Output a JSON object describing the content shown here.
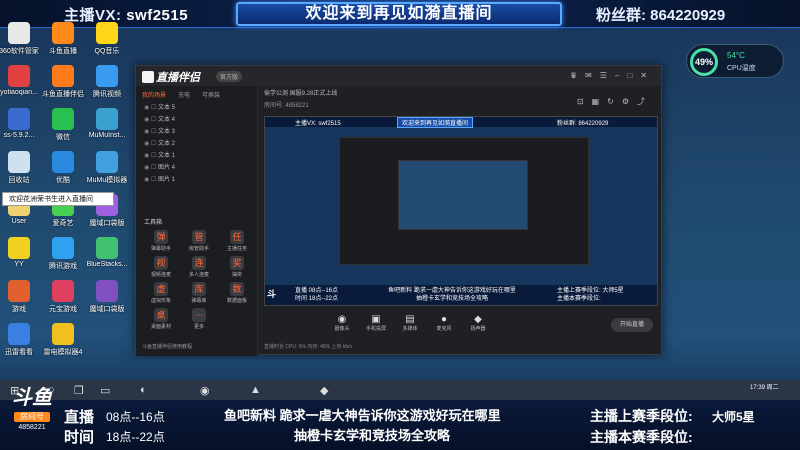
{
  "overlay_top": {
    "host_vx_label": "主播VX:",
    "host_vx_value": "swf2515",
    "banner_title": "欢迎来到再见如漪直播间",
    "fans_group": "粉丝群: 864220929"
  },
  "desktop_icons": [
    {
      "label": "360软件管家",
      "color": "#e8e8e8"
    },
    {
      "label": "斗鱼直播",
      "color": "#ff8a1a"
    },
    {
      "label": "QQ音乐",
      "color": "#ffd51a"
    },
    {
      "label": "yotiaoqian...",
      "color": "#e04040"
    },
    {
      "label": "斗鱼直播伴侣",
      "color": "#ff7a1a"
    },
    {
      "label": "腾讯视频",
      "color": "#3a9af0"
    },
    {
      "label": "ss-5.9.2...",
      "color": "#3a6ad0"
    },
    {
      "label": "微信",
      "color": "#2ac050"
    },
    {
      "label": "MuMuInst...",
      "color": "#3aa0d0"
    },
    {
      "label": "回收站",
      "color": "#d0e0f0"
    },
    {
      "label": "优酷",
      "color": "#2a8ae0"
    },
    {
      "label": "MuMu模拟器",
      "color": "#40a0e0"
    },
    {
      "label": "User",
      "color": "#f0d070"
    },
    {
      "label": "爱奇艺",
      "color": "#4ad050"
    },
    {
      "label": "魔域口袋版",
      "color": "#a060e0"
    },
    {
      "label": "YY",
      "color": "#f0d020"
    },
    {
      "label": "腾讯游戏",
      "color": "#30a0f0"
    },
    {
      "label": "BlueStacks...",
      "color": "#40c070"
    },
    {
      "label": "游戏",
      "color": "#e06030"
    },
    {
      "label": "元宝游戏",
      "color": "#e04060"
    },
    {
      "label": "魔域口袋版",
      "color": "#8050c0"
    },
    {
      "label": "迅雷看看",
      "color": "#3a80e0"
    },
    {
      "label": "雷电模拟器4",
      "color": "#f0c020"
    }
  ],
  "tooltip_text": "欢迎花洲荣书生进入直播间",
  "perf": {
    "percent": "49%",
    "temp": "54°C",
    "cpu": "CPU温度"
  },
  "app": {
    "name": "直播伴侣",
    "version": "官方版",
    "left_tabs": [
      "我的场景",
      "充电",
      "可换装"
    ],
    "layers": [
      "文本 5",
      "文本 4",
      "文本 3",
      "文本 2",
      "文本 1",
      "图片 4",
      "图片 1"
    ],
    "tools_title": "工具箱",
    "tools": [
      {
        "label": "弹幕助手",
        "icon": "弹"
      },
      {
        "label": "房管助手",
        "icon": "管"
      },
      {
        "label": "主播任务",
        "icon": "任"
      },
      {
        "label": "视频连麦",
        "icon": "视"
      },
      {
        "label": "多人连麦",
        "icon": "连"
      },
      {
        "label": "抽奖",
        "icon": "奖"
      },
      {
        "label": "虚拟形象",
        "icon": "虚"
      },
      {
        "label": "弹幕库",
        "icon": "库"
      },
      {
        "label": "数据面板",
        "icon": "数"
      },
      {
        "label": "桌面素材",
        "icon": "桌"
      },
      {
        "label": "更多",
        "icon": "⋯"
      }
    ],
    "left_footer": "斗鱼直播伴侣使用教程",
    "info_line1": "偷学公测 国服9.28正式上线",
    "info_line2": "房间号: 4858221",
    "bottom_tools": [
      {
        "label": "摄像头",
        "icon": "◉"
      },
      {
        "label": "手机投屏",
        "icon": "▣"
      },
      {
        "label": "多媒体",
        "icon": "▤"
      },
      {
        "label": "麦克风",
        "icon": "●"
      },
      {
        "label": "扬声器",
        "icon": "◆"
      }
    ],
    "start_live": "开始直播",
    "status_line": "直播时长 CPU: 5% 内存: 46% 上传 kb/s"
  },
  "preview": {
    "top_left": "主播VX: swf2515",
    "top_title": "欢迎来到再见如漪直播间",
    "top_right": "粉丝群: 864220929",
    "b_live": "直播 08点--16点",
    "b_time": "时间 18点--22点",
    "b_mid1": "鱼吧新料  跪求一虐大神告诉你这游戏好玩在哪里",
    "b_mid2": "抽橙卡玄学和竞技场全攻略",
    "b_rk1": "主播上赛季段位: 大师5星",
    "b_rk2": "主播本赛季段位:"
  },
  "taskbar": {
    "clock": "17:39 周二"
  },
  "overlay_bottom": {
    "logo_main": "斗鱼",
    "logo_tag": "房间号",
    "room_id": "4858221",
    "live_label": "直播",
    "live_value": "08点--16点",
    "time_label": "时间",
    "time_value": "18点--22点",
    "news_line1": "鱼吧新料   跪求一虐大神告诉你这游戏好玩在哪里",
    "news_line2": "抽橙卡玄学和竞技场全攻略",
    "rank_last_label": "主播上赛季段位:",
    "rank_last_value": "大师5星",
    "rank_this_label": "主播本赛季段位:"
  }
}
